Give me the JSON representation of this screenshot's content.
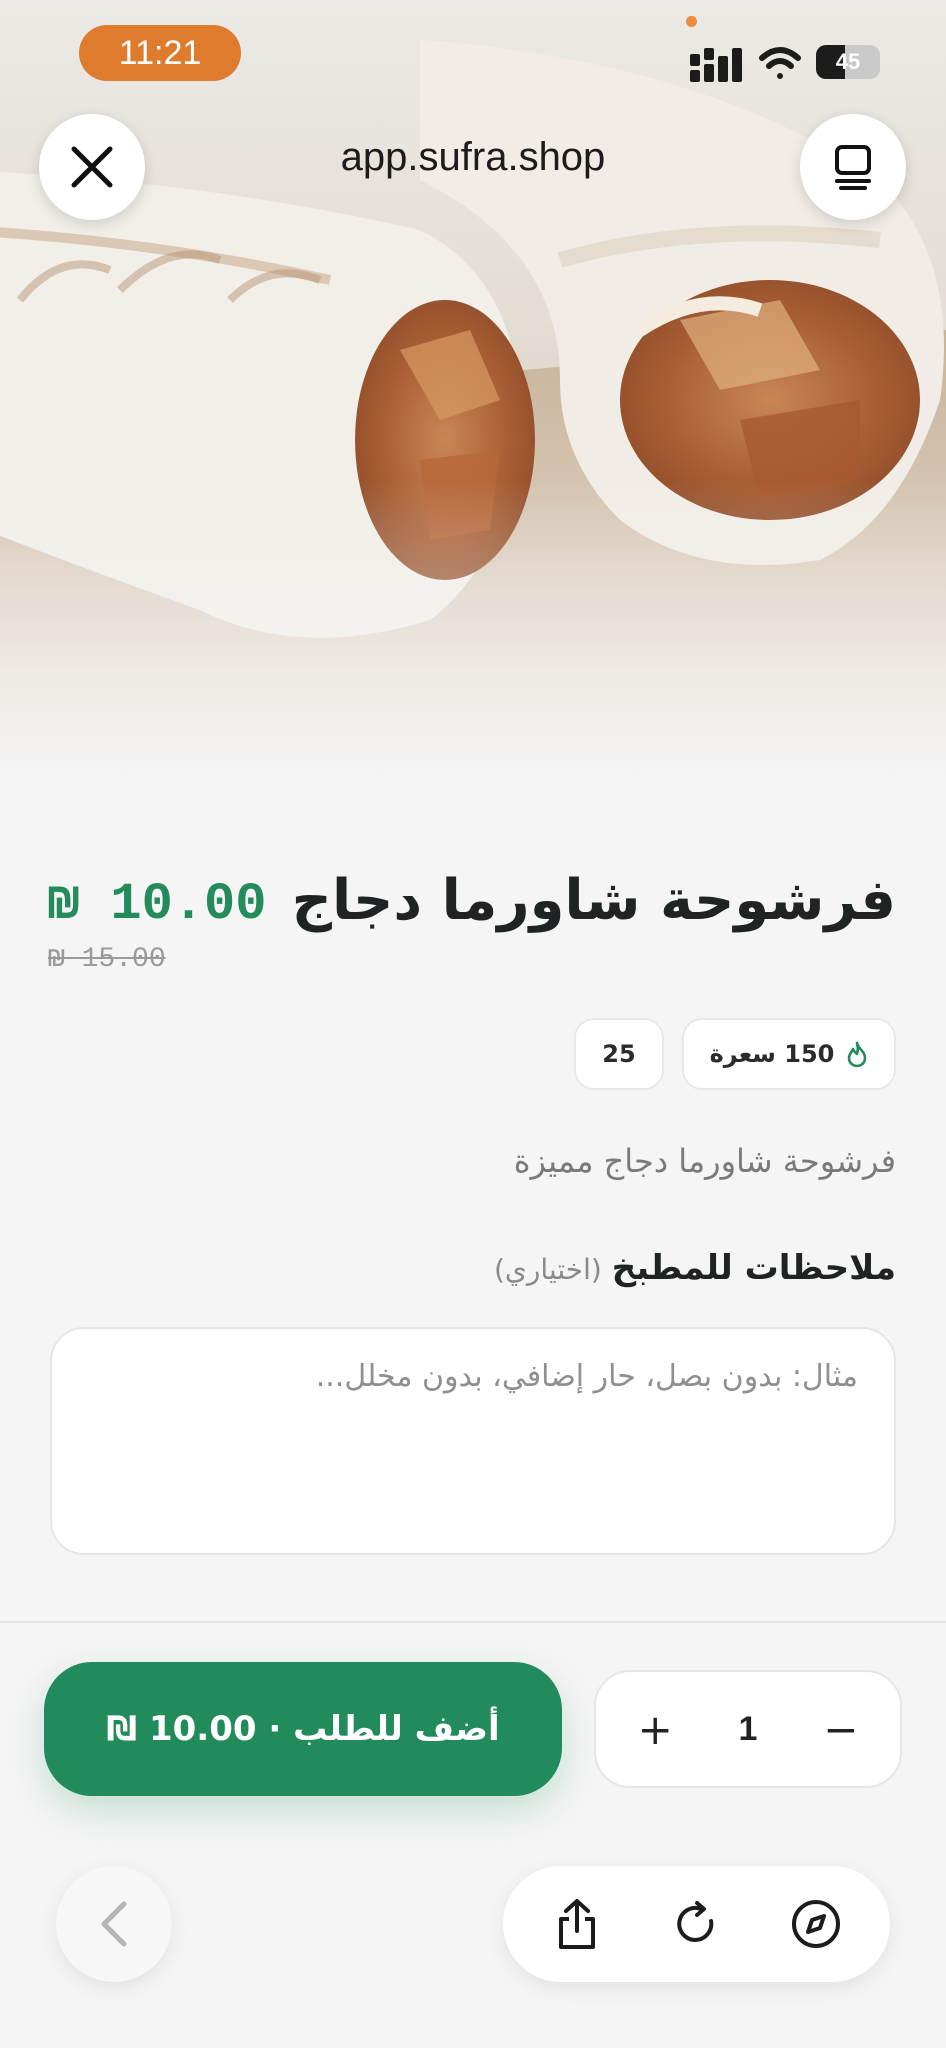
{
  "status_bar": {
    "time": "11:21",
    "battery": "45",
    "battery_level": 0.45
  },
  "browser": {
    "url": "app.sufra.shop",
    "close_icon": "close-icon",
    "tabs_icon": "tabs-icon"
  },
  "product": {
    "title": "فرشوحة شاورما دجاج",
    "price": "₪ 10.00",
    "old_price": "₪ 15.00",
    "calories": "150 سعرة",
    "calories_icon": "flame-icon",
    "badge_count": "25",
    "description": "فرشوحة شاورما دجاج مميزة"
  },
  "notes": {
    "label": "ملاحظات للمطبخ",
    "optional": "(اختياري)",
    "placeholder": "مثال: بدون بصل، حار إضافي، بدون مخلل..."
  },
  "order": {
    "add_label": "أضف للطلب · 10.00 ₪",
    "quantity": "1",
    "plus": "+",
    "minus": "−",
    "accent": "#218b5c"
  },
  "toolbar": {
    "back_icon": "chevron-left-icon",
    "share_icon": "share-icon",
    "reload_icon": "reload-icon",
    "compass_icon": "compass-icon"
  }
}
